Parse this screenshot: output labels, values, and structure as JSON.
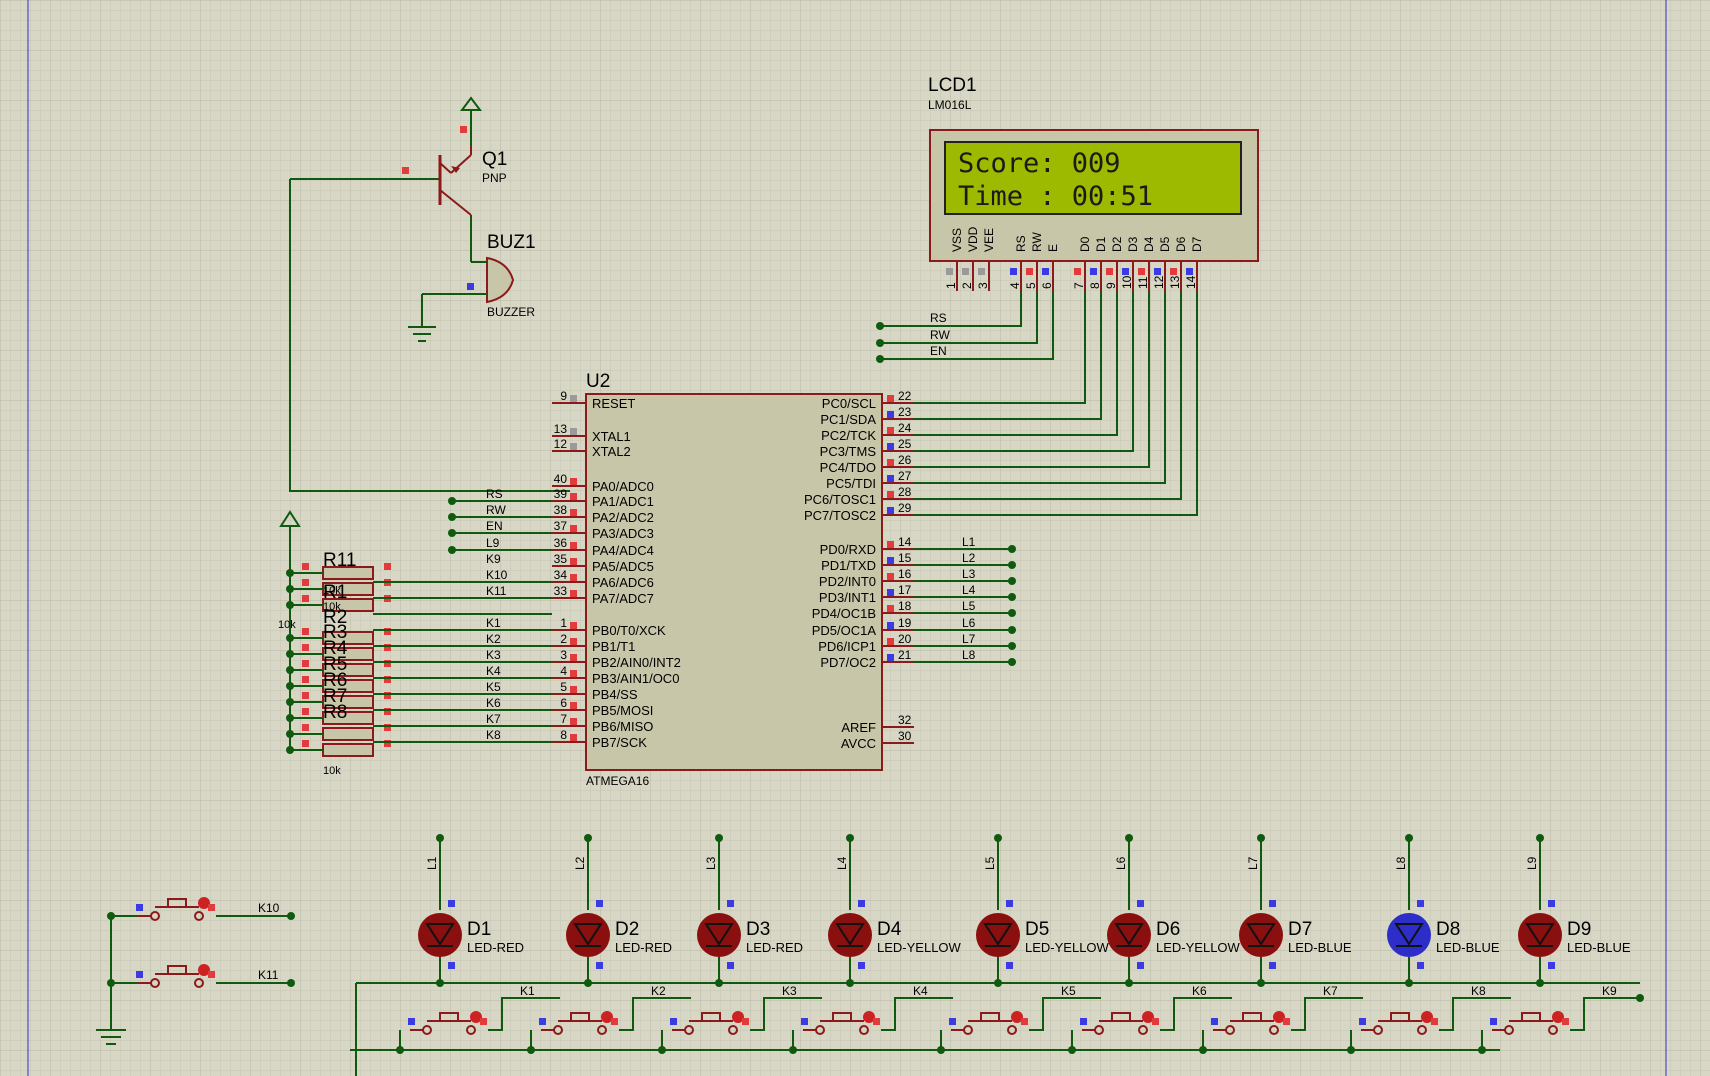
{
  "colors": {
    "sheet": "#d8d7c6",
    "wire": "#0f5a0f",
    "part_outline": "#8b1a1a",
    "part_fill": "#c8c6a8",
    "lcd_screen": "#9dba00",
    "led_red": "#8a0f0f",
    "led_blue_active": "#2d2dc8",
    "pin_red": "#e23b3b",
    "pin_blue": "#3b3be2",
    "pin_grey": "#9a9a9a"
  },
  "lcd": {
    "ref": "LCD1",
    "model": "LM016L",
    "line1": "Score: 009",
    "line2": "Time : 00:51",
    "pin_names": [
      "VSS",
      "VDD",
      "VEE",
      "RS",
      "RW",
      "E",
      "D0",
      "D1",
      "D2",
      "D3",
      "D4",
      "D5",
      "D6",
      "D7"
    ],
    "pin_numbers": [
      "1",
      "2",
      "3",
      "4",
      "5",
      "6",
      "7",
      "8",
      "9",
      "10",
      "11",
      "12",
      "13",
      "14"
    ]
  },
  "transistor": {
    "ref": "Q1",
    "type": "PNP"
  },
  "buzzer": {
    "ref": "BUZ1",
    "type": "BUZZER"
  },
  "mcu": {
    "ref": "U2",
    "model": "ATMEGA16",
    "left_pins": [
      {
        "num": "9",
        "name": "RESET",
        "net": ""
      },
      {
        "num": "13",
        "name": "XTAL1",
        "net": ""
      },
      {
        "num": "12",
        "name": "XTAL2",
        "net": ""
      },
      {
        "num": "40",
        "name": "PA0/ADC0",
        "net": ""
      },
      {
        "num": "39",
        "name": "PA1/ADC1",
        "net": "RS"
      },
      {
        "num": "38",
        "name": "PA2/ADC2",
        "net": "RW"
      },
      {
        "num": "37",
        "name": "PA3/ADC3",
        "net": "EN"
      },
      {
        "num": "36",
        "name": "PA4/ADC4",
        "net": "L9"
      },
      {
        "num": "35",
        "name": "PA5/ADC5",
        "net": "K9"
      },
      {
        "num": "34",
        "name": "PA6/ADC6",
        "net": "K10"
      },
      {
        "num": "33",
        "name": "PA7/ADC7",
        "net": "K11"
      },
      {
        "num": "1",
        "name": "PB0/T0/XCK",
        "net": "K1"
      },
      {
        "num": "2",
        "name": "PB1/T1",
        "net": "K2"
      },
      {
        "num": "3",
        "name": "PB2/AIN0/INT2",
        "net": "K3"
      },
      {
        "num": "4",
        "name": "PB3/AIN1/OC0",
        "net": "K4"
      },
      {
        "num": "5",
        "name": "PB4/SS",
        "net": "K5"
      },
      {
        "num": "6",
        "name": "PB5/MOSI",
        "net": "K6"
      },
      {
        "num": "7",
        "name": "PB6/MISO",
        "net": "K7"
      },
      {
        "num": "8",
        "name": "PB7/SCK",
        "net": "K8"
      }
    ],
    "right_pins": [
      {
        "num": "22",
        "name": "PC0/SCL",
        "net": ""
      },
      {
        "num": "23",
        "name": "PC1/SDA",
        "net": ""
      },
      {
        "num": "24",
        "name": "PC2/TCK",
        "net": ""
      },
      {
        "num": "25",
        "name": "PC3/TMS",
        "net": ""
      },
      {
        "num": "26",
        "name": "PC4/TDO",
        "net": ""
      },
      {
        "num": "27",
        "name": "PC5/TDI",
        "net": ""
      },
      {
        "num": "28",
        "name": "PC6/TOSC1",
        "net": ""
      },
      {
        "num": "29",
        "name": "PC7/TOSC2",
        "net": ""
      },
      {
        "num": "14",
        "name": "PD0/RXD",
        "net": "L1"
      },
      {
        "num": "15",
        "name": "PD1/TXD",
        "net": "L2"
      },
      {
        "num": "16",
        "name": "PD2/INT0",
        "net": "L3"
      },
      {
        "num": "17",
        "name": "PD3/INT1",
        "net": "L4"
      },
      {
        "num": "18",
        "name": "PD4/OC1B",
        "net": "L5"
      },
      {
        "num": "19",
        "name": "PD5/OC1A",
        "net": "L6"
      },
      {
        "num": "20",
        "name": "PD6/ICP1",
        "net": "L7"
      },
      {
        "num": "21",
        "name": "PD7/OC2",
        "net": "L8"
      },
      {
        "num": "32",
        "name": "AREF",
        "net": ""
      },
      {
        "num": "30",
        "name": "AVCC",
        "net": ""
      }
    ]
  },
  "lcd_nets": [
    "RS",
    "RW",
    "EN"
  ],
  "resistors": {
    "top_refs": [
      "R11"
    ],
    "mid_refs": [
      "R1",
      "R2",
      "R3",
      "R4",
      "R5",
      "R6",
      "R7",
      "R8"
    ],
    "value": "10k"
  },
  "leds": [
    {
      "ref": "D1",
      "type": "LED-RED",
      "net": "L1",
      "lit": false
    },
    {
      "ref": "D2",
      "type": "LED-RED",
      "net": "L2",
      "lit": false
    },
    {
      "ref": "D3",
      "type": "LED-RED",
      "net": "L3",
      "lit": false
    },
    {
      "ref": "D4",
      "type": "LED-YELLOW",
      "net": "L4",
      "lit": false
    },
    {
      "ref": "D5",
      "type": "LED-YELLOW",
      "net": "L5",
      "lit": false
    },
    {
      "ref": "D6",
      "type": "LED-YELLOW",
      "net": "L6",
      "lit": false
    },
    {
      "ref": "D7",
      "type": "LED-BLUE",
      "net": "L7",
      "lit": false
    },
    {
      "ref": "D8",
      "type": "LED-BLUE",
      "net": "L8",
      "lit": true
    },
    {
      "ref": "D9",
      "type": "LED-BLUE",
      "net": "L9",
      "lit": false
    }
  ],
  "buttons": {
    "left": [
      "K10",
      "K11"
    ],
    "bottom": [
      "K1",
      "K2",
      "K3",
      "K4",
      "K5",
      "K6",
      "K7",
      "K8",
      "K9"
    ]
  }
}
